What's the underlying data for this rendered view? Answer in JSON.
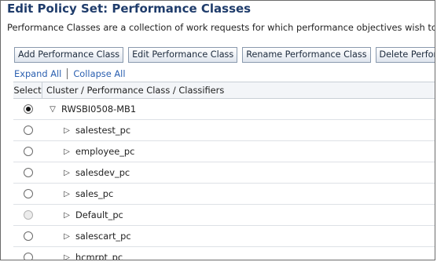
{
  "page": {
    "title": "Edit Policy Set: Performance Classes",
    "description": "Performance Classes are a collection of work requests for which performance objectives wish to be set."
  },
  "toolbar": {
    "add_label": "Add Performance Class",
    "edit_label": "Edit Performance Class",
    "rename_label": "Rename Performance Class",
    "delete_label": "Delete Performance Class"
  },
  "links": {
    "expand_all": "Expand All",
    "collapse_all": "Collapse All"
  },
  "table": {
    "headers": {
      "select": "Select",
      "name": "Cluster / Performance Class / Classifiers"
    },
    "rows": [
      {
        "label": "RWSBI0508-MB1",
        "level": 0,
        "expanded": true,
        "selected": true,
        "disabled": false
      },
      {
        "label": "salestest_pc",
        "level": 1,
        "expanded": false,
        "selected": false,
        "disabled": false
      },
      {
        "label": "employee_pc",
        "level": 1,
        "expanded": false,
        "selected": false,
        "disabled": false
      },
      {
        "label": "salesdev_pc",
        "level": 1,
        "expanded": false,
        "selected": false,
        "disabled": false
      },
      {
        "label": "sales_pc",
        "level": 1,
        "expanded": false,
        "selected": false,
        "disabled": false
      },
      {
        "label": "Default_pc",
        "level": 1,
        "expanded": false,
        "selected": false,
        "disabled": true
      },
      {
        "label": "salescart_pc",
        "level": 1,
        "expanded": false,
        "selected": false,
        "disabled": false
      },
      {
        "label": "hcmrpt_pc",
        "level": 1,
        "expanded": false,
        "selected": false,
        "disabled": false
      }
    ]
  },
  "icons": {
    "info": "info-icon",
    "expanded": "triangle-down-icon",
    "collapsed": "triangle-right-icon"
  },
  "colors": {
    "title": "#1f3c6b",
    "link": "#2a5fb0"
  }
}
